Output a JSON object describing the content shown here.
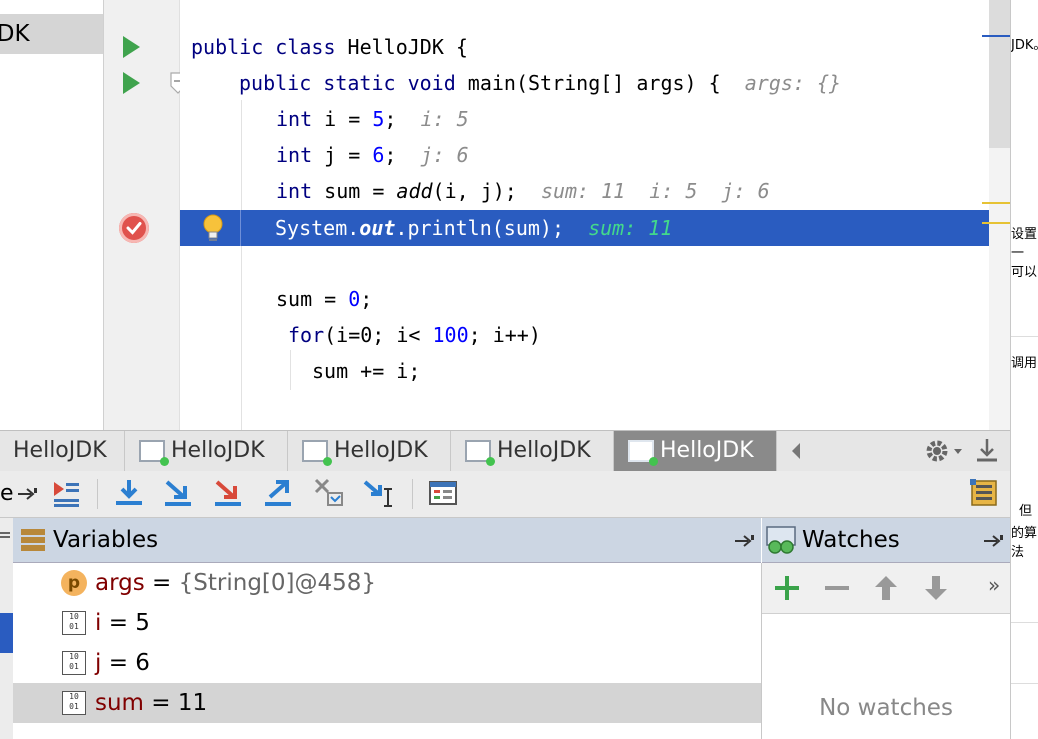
{
  "project": {
    "selected_item": "JDK"
  },
  "editor": {
    "lines": [
      {
        "code": "public class HelloJDK {"
      },
      {
        "code": "public static void main(String[] args) {",
        "hint": "args: {}"
      },
      {
        "code": "int i = 5;",
        "hint": "i: 5"
      },
      {
        "code": "int j = 6;",
        "hint": "j: 6"
      },
      {
        "code": "int sum = add(i, j);",
        "hint": "sum: 11  i: 5  j: 6"
      },
      {
        "code": "System.out.println(sum);",
        "hint": "sum: 11"
      },
      {
        "code": "sum = 0;"
      },
      {
        "code": "for(i=0; i< 100; i++)"
      },
      {
        "code": "sum += i;"
      }
    ]
  },
  "right_panel": {
    "snippets": [
      "JDK。",
      "设置一",
      "可以",
      "调用",
      "但",
      "的算法"
    ]
  },
  "tabs": [
    {
      "label": "HelloJDK"
    },
    {
      "label": "HelloJDK"
    },
    {
      "label": "HelloJDK"
    },
    {
      "label": "HelloJDK"
    },
    {
      "label": "HelloJDK",
      "active": true
    }
  ],
  "toolbar": {
    "left_label": "e"
  },
  "variables": {
    "title": "Variables",
    "rows": [
      {
        "icon": "p",
        "name": "args",
        "eq": " = ",
        "value": "{String[0]@458}"
      },
      {
        "icon": "binary",
        "name": "i",
        "eq": " = ",
        "value": "5"
      },
      {
        "icon": "binary",
        "name": "j",
        "eq": " = ",
        "value": "6"
      },
      {
        "icon": "binary",
        "name": "sum",
        "eq": " = ",
        "value": "11",
        "selected": true
      }
    ]
  },
  "watches": {
    "title": "Watches",
    "empty_text": "No watches",
    "more": "»"
  },
  "colors": {
    "exec_line": "#2a5cc0",
    "keyword": "#000080",
    "number": "#0000ff",
    "var_name": "#800000",
    "run": "#3fa34d"
  }
}
